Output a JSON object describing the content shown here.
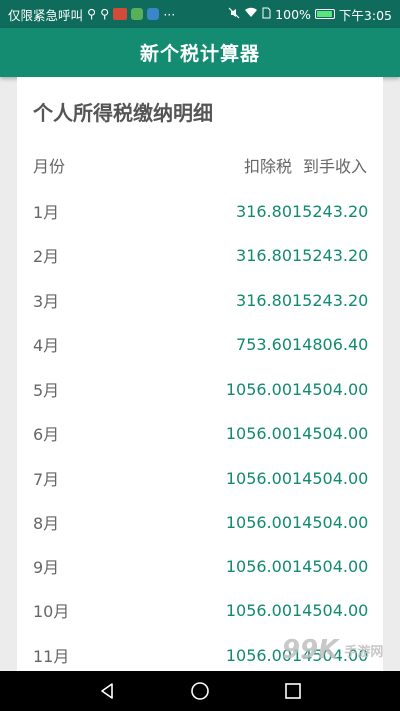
{
  "status_bar": {
    "left_text": "仅限紧急呼叫",
    "more": "···",
    "battery_percent": "100%",
    "time": "下午3:05",
    "icons": [
      "usb-icon",
      "usb-icon",
      "news-app-icon",
      "video-app-icon",
      "chat-app-icon",
      "mute-icon",
      "wifi-icon",
      "sim-icon",
      "battery-icon"
    ]
  },
  "app_bar": {
    "title": "新个税计算器"
  },
  "card": {
    "title": "个人所得税缴纳明细",
    "columns": {
      "month": "月份",
      "tax": "扣除税",
      "income": "到手收入"
    },
    "rows": [
      {
        "month": "1月",
        "tax": "316.80",
        "income": "15243.20"
      },
      {
        "month": "2月",
        "tax": "316.80",
        "income": "15243.20"
      },
      {
        "month": "3月",
        "tax": "316.80",
        "income": "15243.20"
      },
      {
        "month": "4月",
        "tax": "753.60",
        "income": "14806.40"
      },
      {
        "month": "5月",
        "tax": "1056.00",
        "income": "14504.00"
      },
      {
        "month": "6月",
        "tax": "1056.00",
        "income": "14504.00"
      },
      {
        "month": "7月",
        "tax": "1056.00",
        "income": "14504.00"
      },
      {
        "month": "8月",
        "tax": "1056.00",
        "income": "14504.00"
      },
      {
        "month": "9月",
        "tax": "1056.00",
        "income": "14504.00"
      },
      {
        "month": "10月",
        "tax": "1056.00",
        "income": "14504.00"
      },
      {
        "month": "11月",
        "tax": "1056.00",
        "income": "14504.00"
      }
    ]
  },
  "watermark": {
    "mark": "99K",
    "text": "手游网"
  },
  "nav_bar": {
    "buttons": [
      "back-icon",
      "home-icon",
      "recents-icon"
    ]
  },
  "colors": {
    "status_bar": "#0f6b5b",
    "app_bar": "#148c72",
    "value_text": "#118a70",
    "label_text": "#666666"
  }
}
